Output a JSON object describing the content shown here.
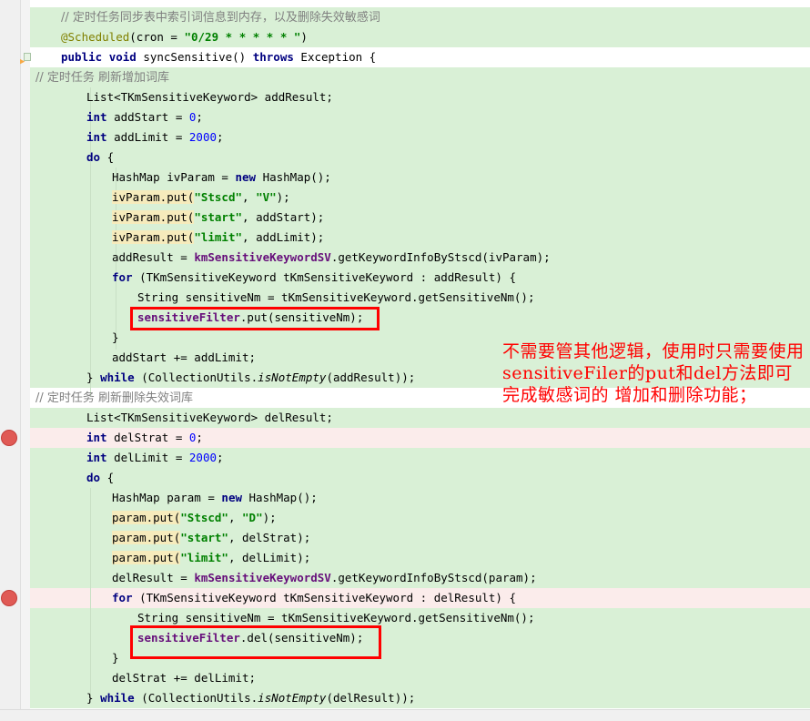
{
  "code": {
    "line1_comment": "// 定时任务同步表中索引词信息到内存，以及删除失效敏感词",
    "line2_annotation": "@Scheduled",
    "line2_rest_a": "(cron = ",
    "line2_string": "\"0/29 * * * * * \"",
    "line2_rest_b": ")",
    "line3_public": "public",
    "line3_void": "void",
    "line3_name": " syncSensitive() ",
    "line3_throws": "throws",
    "line3_rest": " Exception {",
    "comment_add": "// 定时任务 刷新增加词库",
    "add_list": "List<TKmSensitiveKeyword> addResult;",
    "int_kw": "int",
    "add_start": " addStart = ",
    "add_start_val": "0",
    "add_limit": " addLimit = ",
    "add_limit_val": "2000",
    "semi": ";",
    "do_kw": "do",
    "do_rest": " {",
    "hashmap_iv_a": "HashMap ivParam = ",
    "new_kw": "new",
    "hashmap_iv_b": " HashMap();",
    "iv_put1_a": "ivParam.put",
    "iv_put1_b": "(",
    "iv_put1_s1": "\"Stscd\"",
    "iv_put1_c": ", ",
    "iv_put1_s2": "\"V\"",
    "iv_put1_d": ");",
    "iv_put2_a": "ivParam.put",
    "iv_put2_s": "\"start\"",
    "iv_put2_b": ", addStart);",
    "iv_put3_a": "ivParam.put",
    "iv_put3_s": "\"limit\"",
    "iv_put3_b": ", addLimit);",
    "add_result_a": "addResult = ",
    "km_sv": "kmSensitiveKeywordSV",
    "add_result_b": ".getKeywordInfoByStscd(ivParam);",
    "for_kw": "for",
    "for_add_rest": " (TKmSensitiveKeyword tKmSensitiveKeyword : addResult) {",
    "string_nm": "String sensitiveNm = tKmSensitiveKeyword.getSensitiveNm();",
    "sensitive_filter": "sensitiveFilter",
    "put_call": ".put(sensitiveNm);",
    "close_brace": "}",
    "add_start_inc": "addStart += addLimit;",
    "while_close_a": "} ",
    "while_kw": "while",
    "while_mid": " (CollectionUtils.",
    "is_not_empty": "isNotEmpty",
    "while_add_end": "(addResult));",
    "comment_del": "// 定时任务 刷新删除失效词库",
    "del_list": "List<TKmSensitiveKeyword> delResult;",
    "del_strat": " delStrat = ",
    "del_limit": " delLimit = ",
    "hashmap_param_a": "HashMap param = ",
    "param_put": "param.put",
    "param_put1_s1": "\"Stscd\"",
    "param_put1_s2": "\"D\"",
    "param_put2_s": "\"start\"",
    "param_put2_b": ", delStrat);",
    "param_put3_s": "\"limit\"",
    "param_put3_b": ", delLimit);",
    "del_result_a": "delResult = ",
    "del_result_b": ".getKeywordInfoByStscd(param);",
    "for_del_rest": " (TKmSensitiveKeyword tKmSensitiveKeyword : delResult) {",
    "del_call": ".del(sensitiveNm);",
    "del_strat_inc": "delStrat += delLimit;",
    "while_del_end": "(delResult));"
  },
  "note_text": "不需要管其他逻辑，使用时只需要使用 sensitiveFiler的put和del方法即可完成敏感词的 增加和删除功能；",
  "colors": {
    "changed_bg": "#d9f0d6",
    "breakpoint_line_bg": "#fbeceb",
    "breakpoint": "#e05a55",
    "highlight_box": "#ff0000",
    "note_text": "#ff0000",
    "keyword": "#000080",
    "string": "#008000",
    "field": "#660e7a",
    "comment": "#808080",
    "annotation": "#808000"
  },
  "icons": [
    "breakpoint-icon",
    "fold-icon",
    "method-override-icon"
  ]
}
